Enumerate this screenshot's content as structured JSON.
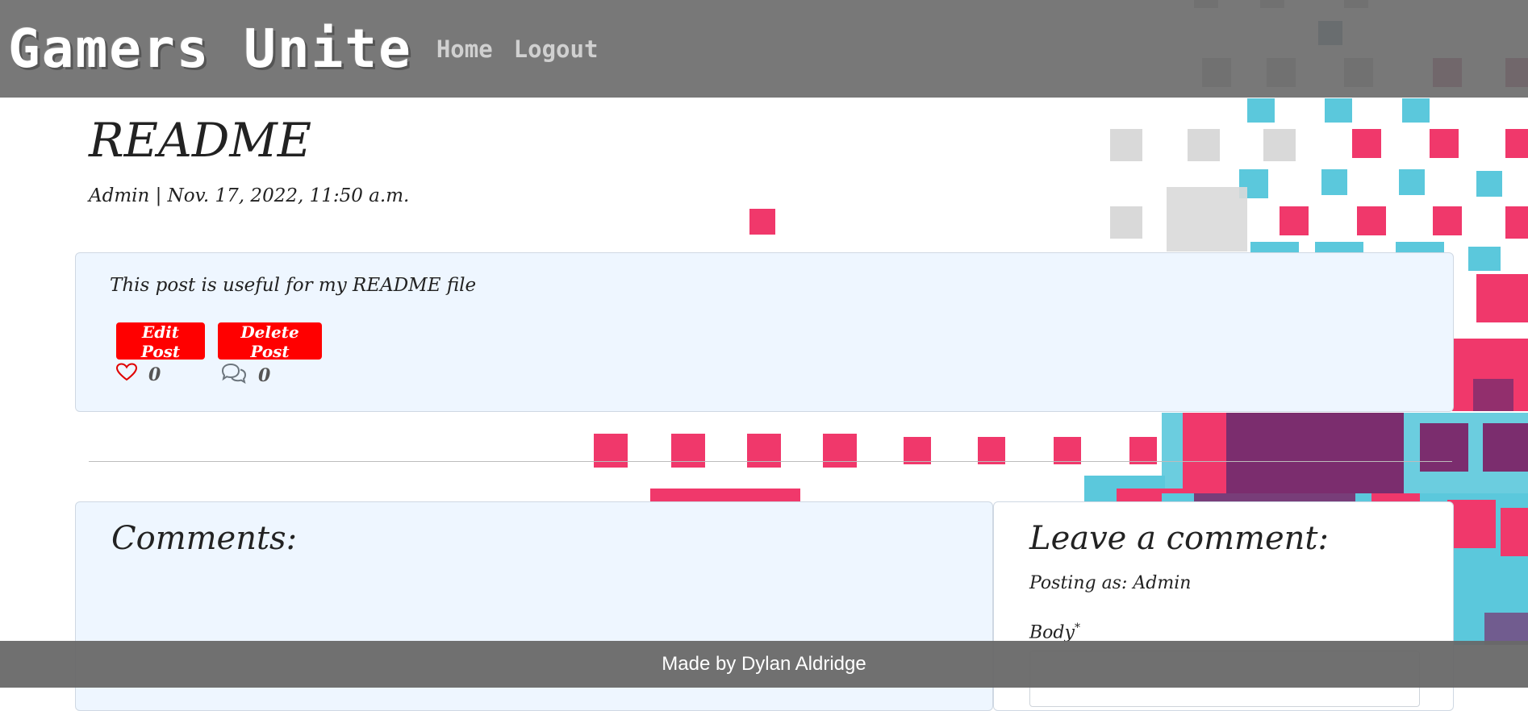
{
  "navbar": {
    "brand": "Gamers Unite",
    "links": [
      "Home",
      "Logout"
    ]
  },
  "post": {
    "title": "README",
    "meta": "Admin | Nov. 17, 2022, 11:50 a.m.",
    "body": "This post is useful for my README file",
    "edit_label": "Edit Post",
    "delete_label": "Delete Post",
    "likes": "0",
    "comments": "0"
  },
  "comments_section": {
    "heading": "Comments:"
  },
  "leave_comment": {
    "heading": "Leave a comment:",
    "posting_as": "Posting as: Admin",
    "body_label": "Body",
    "required_mark": "*"
  },
  "footer": {
    "text": "Made by Dylan Aldridge"
  },
  "colors": {
    "accent": "#ff0000",
    "card_bg": "#eef6ff",
    "pixel_pink": "#f0386b",
    "pixel_cyan": "#5bc8dc",
    "pixel_purple": "#7b2d6e",
    "pixel_gray": "#d9d9d9"
  }
}
